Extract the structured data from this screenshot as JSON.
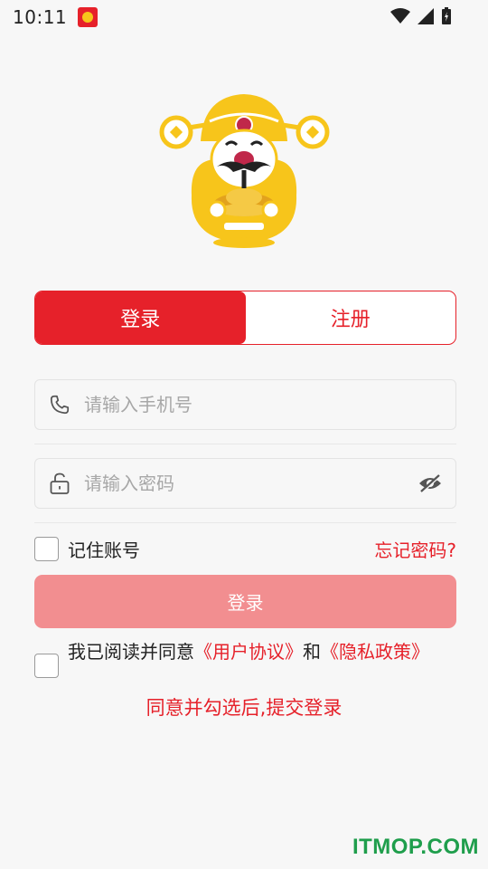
{
  "status_bar": {
    "time": "10:11"
  },
  "tabs": {
    "login": "登录",
    "register": "注册"
  },
  "phone": {
    "placeholder": "请输入手机号"
  },
  "password": {
    "placeholder": "请输入密码"
  },
  "remember": {
    "label": "记住账号",
    "forgot": "忘记密码?"
  },
  "login_button": {
    "label": "登录"
  },
  "agreement": {
    "prefix": "我已阅读并同意",
    "user_agreement": "《用户协议》",
    "and": "和",
    "privacy": "《隐私政策》"
  },
  "hint": "同意并勾选后,提交登录",
  "watermark": "ITMOP.COM",
  "colors": {
    "accent": "#e6212a",
    "button_disabled": "#f28e90",
    "mascot_gold": "#f7c51b"
  }
}
